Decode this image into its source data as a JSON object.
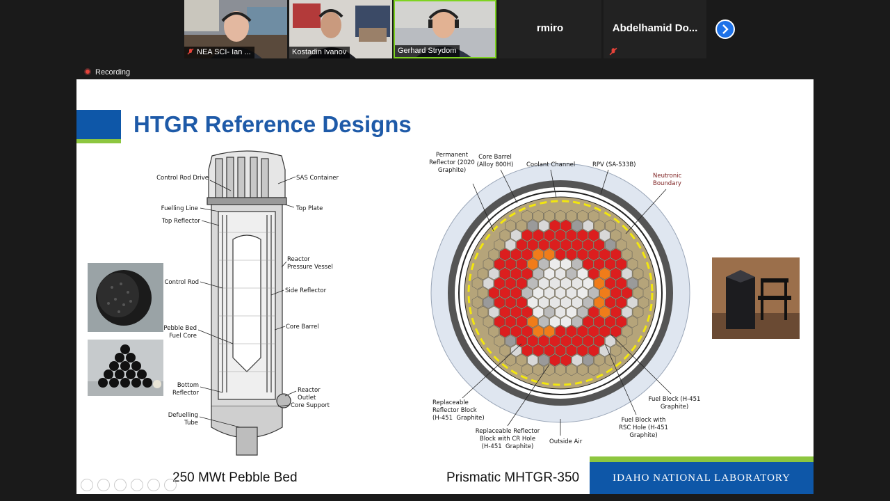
{
  "participants": [
    {
      "name": "NEA SCI- Ian ...",
      "muted": true
    },
    {
      "name": "Kostadin Ivanov",
      "muted": false
    },
    {
      "name": "Gerhard Strydom",
      "muted": false,
      "active": true
    },
    {
      "name": "rmiro",
      "muted": true
    },
    {
      "name": "Abdelhamid Do...",
      "muted": true
    }
  ],
  "recording_label": "Recording",
  "slide": {
    "title": "HTGR Reference Designs",
    "caption_left": "250 MWt Pebble Bed",
    "caption_right": "Prismatic MHTGR-350",
    "footer": "IDAHO NATIONAL LABORATORY",
    "pebble_labels": {
      "control_rod_drive": "Control Rod Drive",
      "sas_container": "SAS Container",
      "fuelling_line": "Fuelling Line",
      "top_plate": "Top Plate",
      "top_reflector": "Top Reflector",
      "reactor_pressure_vessel": "Reactor\nPressure Vessel",
      "control_rod": "Control Rod",
      "side_reflector": "Side Reflector",
      "core_barrel": "Core Barrel",
      "pebble_bed_fuel_core": "Pebble Bed\nFuel Core",
      "bottom_reflector": "Bottom\nReflector",
      "reactor_outlet": "Reactor\nOutlet",
      "core_support": "Core Support",
      "defuelling_tube": "Defuelling\nTube"
    },
    "prismatic_labels": {
      "permanent_reflector": "Permanent\nReflector (2020\nGraphite)",
      "core_barrel": "Core Barrel\n(Alloy 800H)",
      "coolant_channel": "Coolant Channel",
      "rpv": "RPV (SA-533B)",
      "neutronic_boundary": "Neutronic\nBoundary",
      "replaceable_reflector_block": "Replaceable\nReflector Block\n(H-451  Graphite)",
      "replaceable_reflector_cr": "Replaceable Reflector\nBlock with CR Hole\n(H-451  Graphite)",
      "outside_air": "Outside Air",
      "fuel_block_rsc": "Fuel Block with\nRSC Hole (H-451\nGraphite)",
      "fuel_block": "Fuel Block (H-451\nGraphite)"
    }
  },
  "colors": {
    "title_blue": "#1e5aa8",
    "bar_blue": "#0e57a8",
    "bar_green": "#8dc63f",
    "active_speaker": "#7ed321",
    "fuel_red": "#dc1e1e",
    "fuel_orange": "#f07c1a",
    "reflector_tan": "#b5a47a"
  }
}
